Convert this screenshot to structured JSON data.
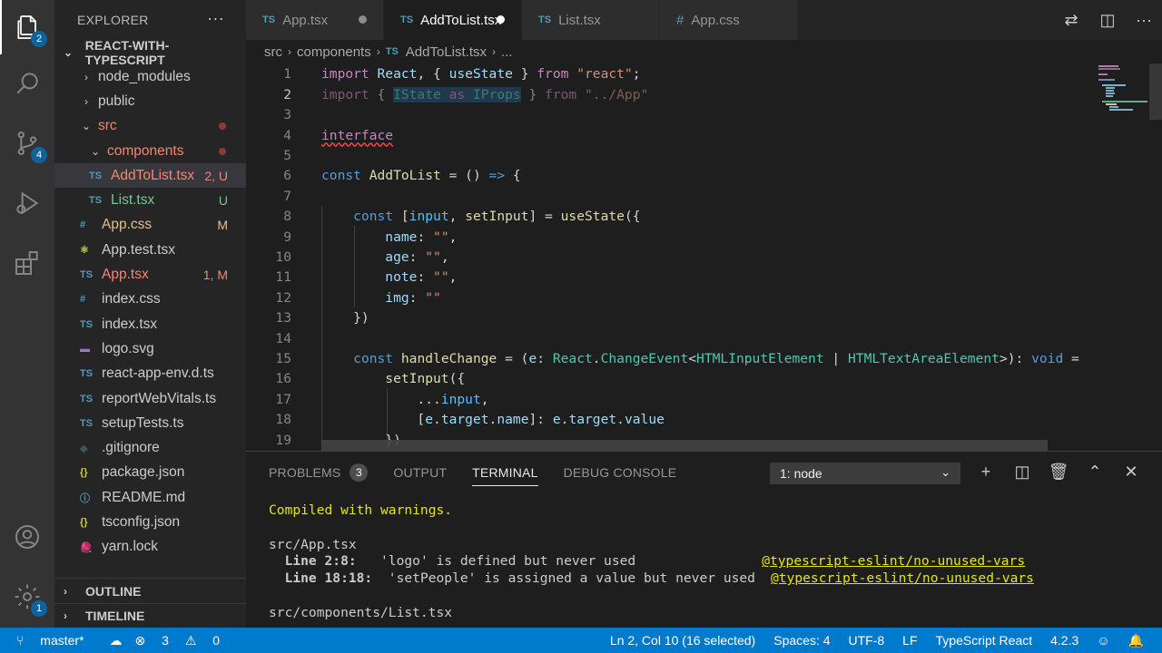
{
  "activity_bar": {
    "explorer_badge": "2",
    "scm_badge": "4",
    "manage_badge": "1"
  },
  "sidebar": {
    "title": "EXPLORER",
    "more": "···",
    "project": "REACT-WITH-TYPESCRIPT",
    "tree": [
      {
        "label": "node_modules",
        "indent": 1,
        "twisty": "›",
        "color": "norm"
      },
      {
        "label": "public",
        "indent": 1,
        "twisty": "›",
        "color": "norm"
      },
      {
        "label": "src",
        "indent": 1,
        "twisty": "⌄",
        "color": "err",
        "dot": true
      },
      {
        "label": "components",
        "indent": 2,
        "twisty": "⌄",
        "color": "err",
        "dot": true
      },
      {
        "label": "AddToList.tsx",
        "indent": 3,
        "icon": "TS",
        "iconClass": "ic-ts",
        "color": "err",
        "badge": "2, U",
        "selected": true
      },
      {
        "label": "List.tsx",
        "indent": 3,
        "icon": "TS",
        "iconClass": "ic-ts",
        "color": "new",
        "badge": "U"
      },
      {
        "label": "App.css",
        "indent": 2,
        "icon": "#",
        "iconClass": "ic-css",
        "color": "mod",
        "badge": "M"
      },
      {
        "label": "App.test.tsx",
        "indent": 2,
        "icon": "⚛",
        "iconClass": "ic-test",
        "color": "norm"
      },
      {
        "label": "App.tsx",
        "indent": 2,
        "icon": "TS",
        "iconClass": "ic-ts",
        "color": "err",
        "badge": "1, M"
      },
      {
        "label": "index.css",
        "indent": 2,
        "icon": "#",
        "iconClass": "ic-css",
        "color": "norm"
      },
      {
        "label": "index.tsx",
        "indent": 2,
        "icon": "TS",
        "iconClass": "ic-ts",
        "color": "norm"
      },
      {
        "label": "logo.svg",
        "indent": 2,
        "icon": "▬",
        "iconClass": "ic-svg",
        "color": "norm"
      },
      {
        "label": "react-app-env.d.ts",
        "indent": 2,
        "icon": "TS",
        "iconClass": "ic-ts",
        "color": "norm"
      },
      {
        "label": "reportWebVitals.ts",
        "indent": 2,
        "icon": "TS",
        "iconClass": "ic-ts",
        "color": "norm"
      },
      {
        "label": "setupTests.ts",
        "indent": 2,
        "icon": "TS",
        "iconClass": "ic-ts",
        "color": "norm"
      },
      {
        "label": ".gitignore",
        "indent": 1,
        "icon": "◆",
        "iconClass": "ic-git",
        "color": "norm"
      },
      {
        "label": "package.json",
        "indent": 1,
        "icon": "{}",
        "iconClass": "ic-json",
        "color": "norm"
      },
      {
        "label": "README.md",
        "indent": 1,
        "icon": "ⓘ",
        "iconClass": "ic-md",
        "color": "norm"
      },
      {
        "label": "tsconfig.json",
        "indent": 1,
        "icon": "{}",
        "iconClass": "ic-json",
        "color": "norm"
      },
      {
        "label": "yarn.lock",
        "indent": 1,
        "icon": "🧶",
        "iconClass": "ic-yarn",
        "color": "norm"
      }
    ],
    "outline": "OUTLINE",
    "timeline": "TIMELINE"
  },
  "tabs": [
    {
      "label": "App.tsx",
      "icon": "TS",
      "dirty": true,
      "active": false
    },
    {
      "label": "AddToList.tsx",
      "icon": "TS",
      "dirty": true,
      "active": true
    },
    {
      "label": "List.tsx",
      "icon": "TS",
      "dirty": false,
      "active": false
    },
    {
      "label": "App.css",
      "icon": "#",
      "dirty": false,
      "active": false
    }
  ],
  "breadcrumb": {
    "part1": "src",
    "part2": "components",
    "file_icon": "TS",
    "file": "AddToList.tsx",
    "more": "..."
  },
  "editor": {
    "line_numbers": [
      "1",
      "2",
      "3",
      "4",
      "5",
      "6",
      "7",
      "8",
      "9",
      "10",
      "11",
      "12",
      "13",
      "14",
      "15",
      "16",
      "17",
      "18",
      "19"
    ]
  },
  "panel": {
    "problems": "PROBLEMS",
    "problems_count": "3",
    "output": "OUTPUT",
    "terminal": "TERMINAL",
    "debug": "DEBUG CONSOLE",
    "terminal_select": "1: node",
    "lines": {
      "compiled": "Compiled with warnings.",
      "file1": "src/App.tsx",
      "w1_loc": "  Line 2:8:",
      "w1_msg": "   'logo' is defined but never used",
      "w1_rule": "@typescript-eslint/no-unused-vars",
      "w2_loc": "  Line 18:18:",
      "w2_msg": "  'setPeople' is assigned a value but never used",
      "w2_rule": "@typescript-eslint/no-unused-vars",
      "file2": "src/components/List.tsx"
    }
  },
  "status": {
    "branch": "master*",
    "errors": "3",
    "warnings": "0",
    "position": "Ln 2, Col 10 (16 selected)",
    "spaces": "Spaces: 4",
    "encoding": "UTF-8",
    "eol": "LF",
    "language": "TypeScript React",
    "version": "4.2.3"
  }
}
